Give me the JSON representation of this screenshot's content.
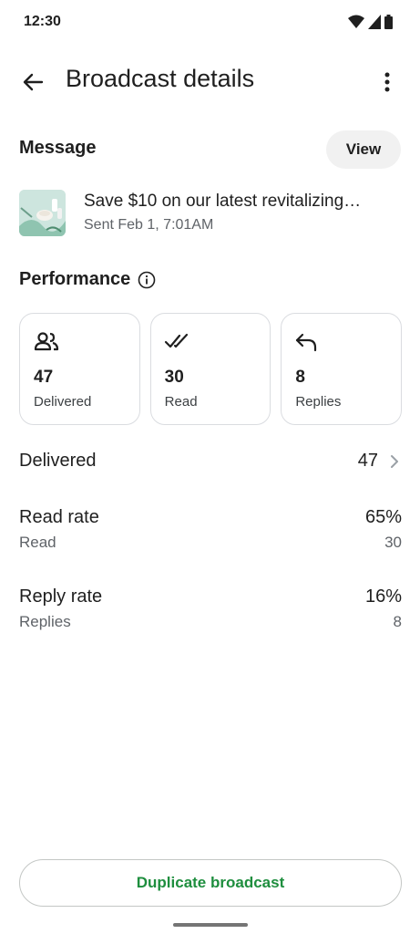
{
  "status_bar": {
    "time": "12:30"
  },
  "app_bar": {
    "title": "Broadcast details"
  },
  "message": {
    "section_label": "Message",
    "view_label": "View",
    "title": "Save $10 on our latest revitalizing…",
    "sent": "Sent Feb 1, 7:01AM"
  },
  "performance": {
    "section_label": "Performance",
    "cards": [
      {
        "icon": "people-icon",
        "value": "47",
        "label": "Delivered"
      },
      {
        "icon": "double-check-icon",
        "value": "30",
        "label": "Read"
      },
      {
        "icon": "reply-icon",
        "value": "8",
        "label": "Replies"
      }
    ]
  },
  "stats": {
    "delivered": {
      "label": "Delivered",
      "value": "47"
    },
    "read_rate": {
      "label": "Read rate",
      "value": "65%",
      "sub_label": "Read",
      "sub_value": "30"
    },
    "reply_rate": {
      "label": "Reply rate",
      "value": "16%",
      "sub_label": "Replies",
      "sub_value": "8"
    }
  },
  "actions": {
    "duplicate_label": "Duplicate broadcast"
  },
  "colors": {
    "accent_green": "#1e8e3e",
    "card_border": "#dadce0",
    "secondary_text": "#5f6368"
  }
}
